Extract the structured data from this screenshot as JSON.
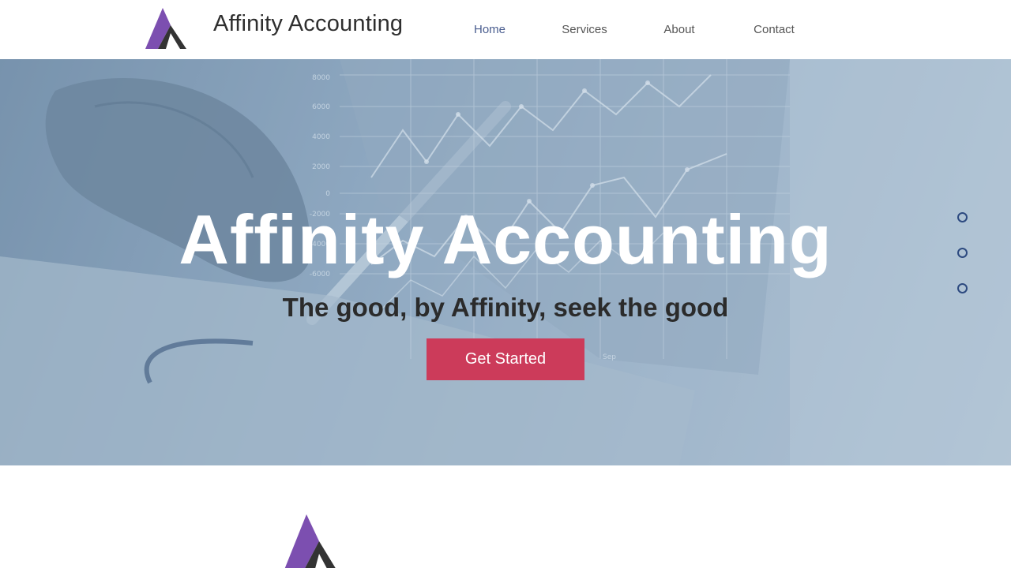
{
  "header": {
    "site_title": "Affinity Accounting",
    "nav": [
      {
        "label": "Home",
        "active": true
      },
      {
        "label": "Services",
        "active": false
      },
      {
        "label": "About",
        "active": false
      },
      {
        "label": "Contact",
        "active": false
      }
    ]
  },
  "hero": {
    "title": "Affinity Accounting",
    "subtitle": "The good, by Affinity, seek the good",
    "cta_label": "Get Started",
    "chart_ticks": [
      "8000",
      "6000",
      "4000",
      "2000",
      "0",
      "-2000",
      "-4000",
      "-6000"
    ],
    "chart_month": "Sep",
    "slide_count": 3
  },
  "colors": {
    "accent_button": "#cc3b5a",
    "nav_active": "#4a5d8f",
    "logo_purple": "#7c4fb0",
    "logo_dark": "#333333",
    "dot_border": "#2d4a80"
  },
  "icons": {
    "logo": "affinity-triangle-logo",
    "slide_dots": "hollow-circle"
  }
}
